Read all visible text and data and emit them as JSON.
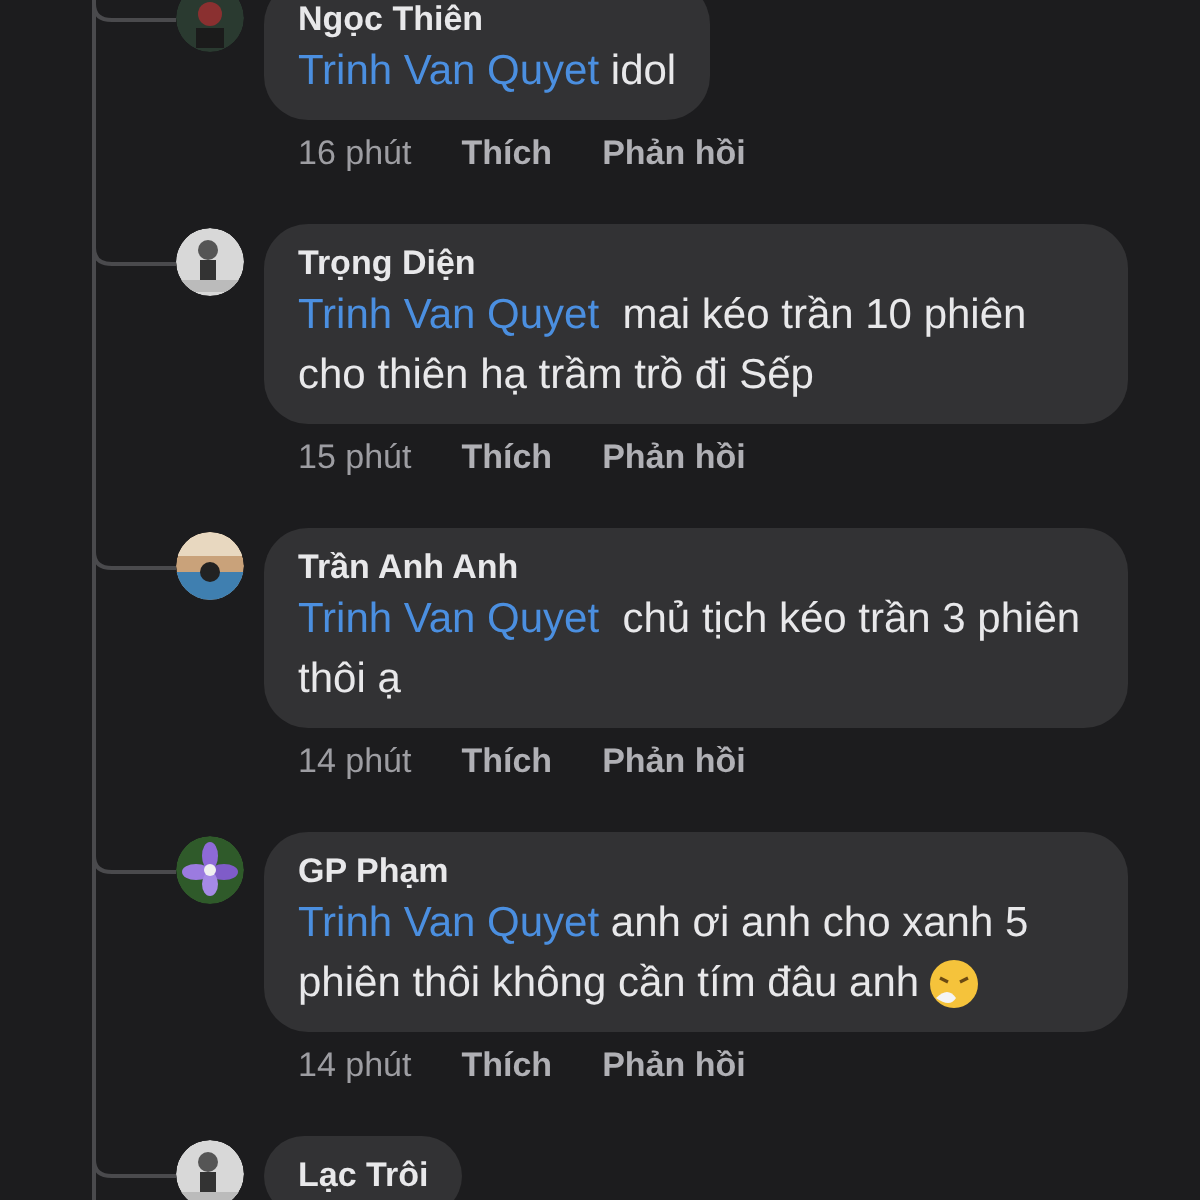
{
  "comments": [
    {
      "author": "Ngọc Thiên",
      "mention": "Trinh Van Quyet",
      "text": " idol",
      "time": "16 phút",
      "like": "Thích",
      "reply": "Phản hồi"
    },
    {
      "author": "Trọng Diện",
      "mention": "Trinh Van Quyet",
      "text": "  mai kéo trần 10 phiên cho thiên hạ trầm trồ đi Sếp",
      "time": "15 phút",
      "like": "Thích",
      "reply": "Phản hồi"
    },
    {
      "author": "Trần Anh Anh",
      "mention": "Trinh Van Quyet",
      "text": "  chủ tịch kéo trần 3 phiên thôi ạ",
      "time": "14 phút",
      "like": "Thích",
      "reply": "Phản hồi"
    },
    {
      "author": "GP Phạm",
      "mention": "Trinh Van Quyet",
      "text": " anh ơi anh cho xanh 5 phiên thôi không cần tím đâu anh",
      "emoji": true,
      "time": "14 phút",
      "like": "Thích",
      "reply": "Phản hồi"
    },
    {
      "author": "Lạc Trôi"
    }
  ]
}
